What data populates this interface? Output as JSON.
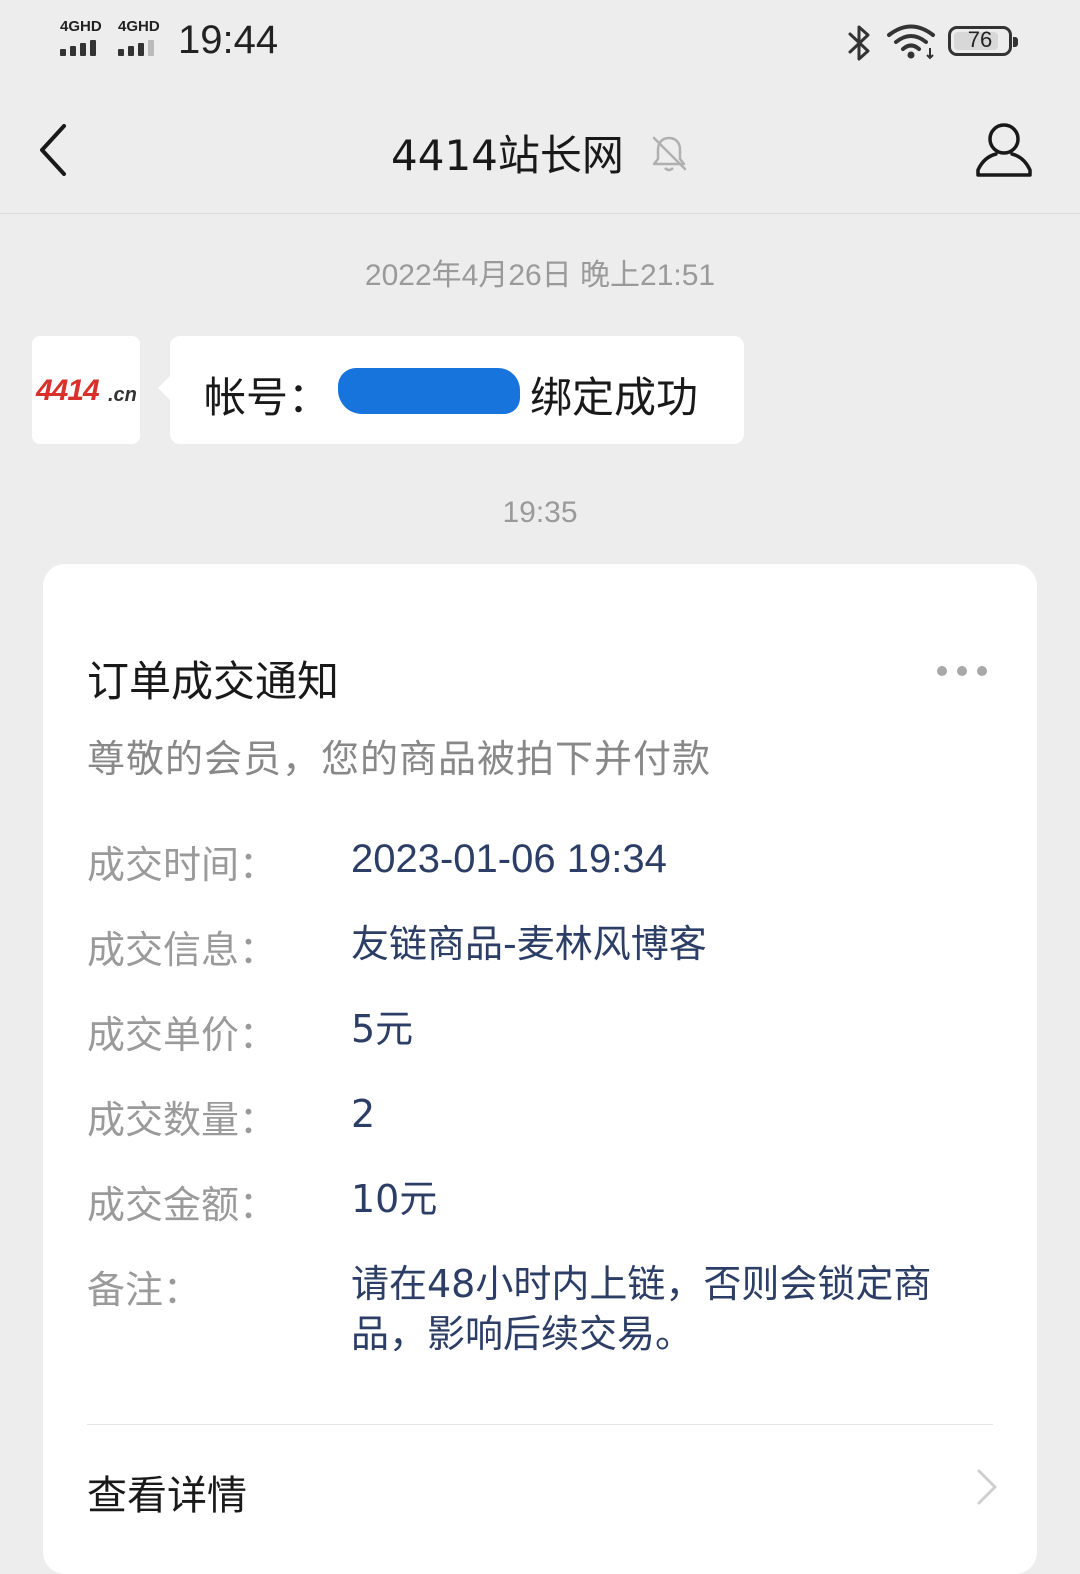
{
  "status_bar": {
    "sim1_label": "4GHD",
    "sim2_label": "4GHD",
    "time": "19:44",
    "battery_level": "76"
  },
  "nav": {
    "title": "4414站长网"
  },
  "chat": {
    "timestamp_1": "2022年4月26日 晚上21:51",
    "sender_logo_main": "4414",
    "sender_logo_tld": ".cn",
    "message_prefix": "帐号：",
    "message_suffix": "绑定成功",
    "timestamp_2": "19:35"
  },
  "notice": {
    "title": "订单成交通知",
    "subtitle": "尊敬的会员，您的商品被拍下并付款",
    "fields": [
      {
        "label": "成交时间：",
        "value": "2023-01-06 19:34"
      },
      {
        "label": "成交信息：",
        "value": "友链商品-麦林风博客"
      },
      {
        "label": "成交单价：",
        "value": "5元"
      },
      {
        "label": "成交数量：",
        "value": "2"
      },
      {
        "label": "成交金额：",
        "value": "10元"
      },
      {
        "label": "备注：",
        "value": "请在48小时内上链，否则会锁定商品，影响后续交易。"
      }
    ],
    "details_label": "查看详情"
  },
  "colors": {
    "background": "#ededed",
    "card": "#ffffff",
    "label_gray": "#9a9a9a",
    "value_navy": "#2c3e66",
    "redaction_blue": "#1874dd",
    "logo_red": "#d9302b"
  }
}
